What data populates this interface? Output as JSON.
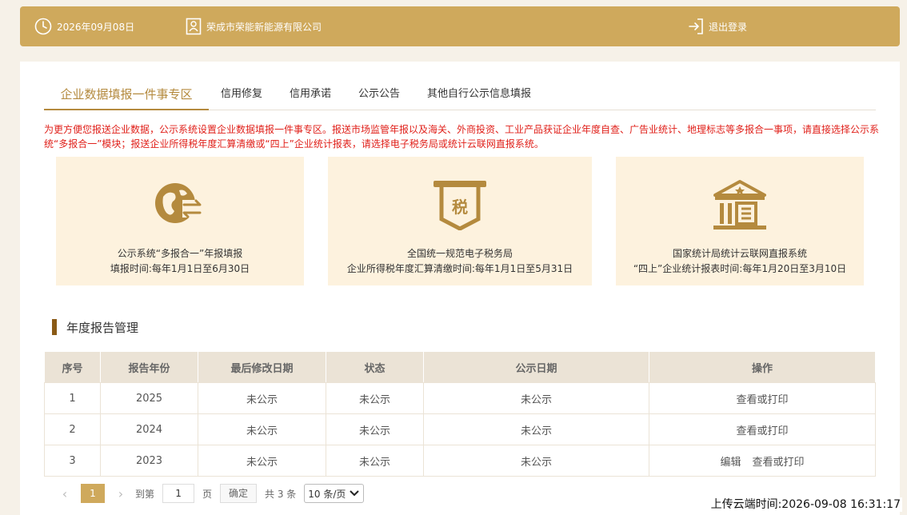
{
  "header": {
    "date": "2026年09月08日",
    "company": "荣成市荣能新能源有限公司",
    "logout": "退出登录"
  },
  "tabs": [
    {
      "label": "企业数据填报一件事专区",
      "active": true
    },
    {
      "label": "信用修复"
    },
    {
      "label": "信用承诺"
    },
    {
      "label": "公示公告"
    },
    {
      "label": "其他自行公示信息填报"
    }
  ],
  "notice": "为更方便您报送企业数据，公示系统设置企业数据填报一件事专区。报送市场监管年报以及海关、外商投资、工业产品获证企业年度自查、广告业统计、地理标志等多报合一事项，请直接选择公示系统“多报合一”模块；报送企业所得税年度汇算清缴或“四上”企业统计报表，请选择电子税务局或统计云联网直报系统。",
  "cards": [
    {
      "icon": "globe-exchange-icon",
      "title": "公示系统“多报合一”年报填报",
      "subtitle": "填报时间:每年1月1日至6月30日"
    },
    {
      "icon": "tax-icon",
      "icon_text": "税",
      "title": "全国统一规范电子税务局",
      "subtitle": "企业所得税年度汇算清缴时间:每年1月1日至5月31日"
    },
    {
      "icon": "government-building-icon",
      "title": "国家统计局统计云联网直报系统",
      "subtitle": "“四上”企业统计报表时间:每年1月20日至3月10日"
    }
  ],
  "section_title": "年度报告管理",
  "table": {
    "columns": [
      "序号",
      "报告年份",
      "最后修改日期",
      "状态",
      "公示日期",
      "操作"
    ],
    "rows": [
      {
        "no": "1",
        "year": "2025",
        "modified": "未公示",
        "status": "未公示",
        "publish": "未公示",
        "actions": [
          "查看或打印"
        ]
      },
      {
        "no": "2",
        "year": "2024",
        "modified": "未公示",
        "status": "未公示",
        "publish": "未公示",
        "actions": [
          "查看或打印"
        ]
      },
      {
        "no": "3",
        "year": "2023",
        "modified": "未公示",
        "status": "未公示",
        "publish": "未公示",
        "actions": [
          "编辑",
          "查看或打印"
        ]
      }
    ]
  },
  "pager": {
    "prev": "‹",
    "current": "1",
    "next": "›",
    "goto_label": "到第",
    "goto_value": "1",
    "page_unit": "页",
    "confirm": "确定",
    "total": "共 3 条",
    "page_size": "10 条/页"
  },
  "upload_time": "上传云端时间:2026-09-08 16:31:17",
  "colors": {
    "accent": "#cfa95c",
    "accent_dark": "#b48a3e",
    "card_bg": "#fdf2de",
    "notice": "#e0201a",
    "title_bar": "#8a5a16"
  }
}
